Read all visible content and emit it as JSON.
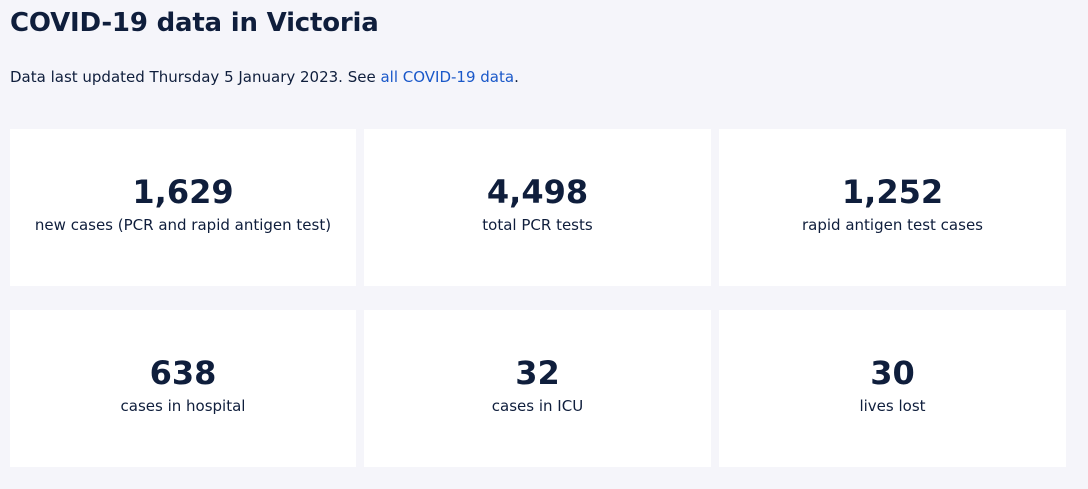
{
  "header": {
    "title": "COVID-19 data in Victoria"
  },
  "update": {
    "prefix": "Data last updated Thursday 5 January 2023. See ",
    "link_text": "all COVID-19 data",
    "suffix": "."
  },
  "stats": [
    {
      "value": "1,629",
      "label": "new cases (PCR and rapid antigen test)"
    },
    {
      "value": "4,498",
      "label": "total PCR tests"
    },
    {
      "value": "1,252",
      "label": "rapid antigen test cases"
    },
    {
      "value": "638",
      "label": "cases in hospital"
    },
    {
      "value": "32",
      "label": "cases in ICU"
    },
    {
      "value": "30",
      "label": "lives lost"
    }
  ],
  "colors": {
    "background": "#f5f5fa",
    "card": "#ffffff",
    "text": "#0f1e3c",
    "link": "#1a58c9"
  }
}
